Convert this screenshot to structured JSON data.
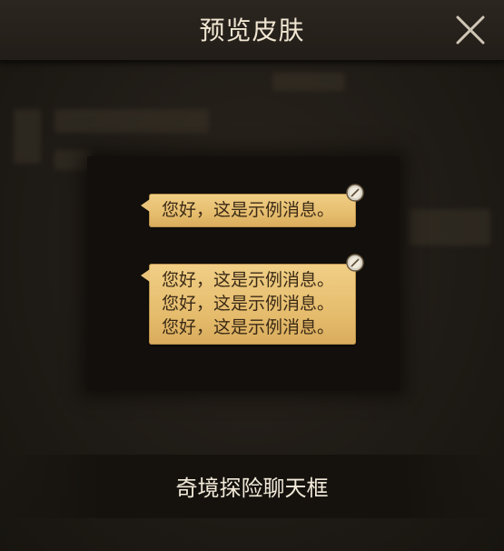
{
  "dialog": {
    "title": "预览皮肤",
    "close_icon": "close-icon"
  },
  "preview": {
    "bubbles": [
      {
        "lines": [
          "您好，这是示例消息。"
        ]
      },
      {
        "lines": [
          "您好，这是示例消息。",
          "您好，这是示例消息。",
          "您好，这是示例消息。"
        ]
      }
    ],
    "pin_icon": "compass-pin-icon"
  },
  "footer": {
    "skin_name": "奇境探险聊天框"
  },
  "colors": {
    "bubble": "#e8c27a",
    "title_text": "#f0e6d2",
    "background": "#1e1a15"
  }
}
